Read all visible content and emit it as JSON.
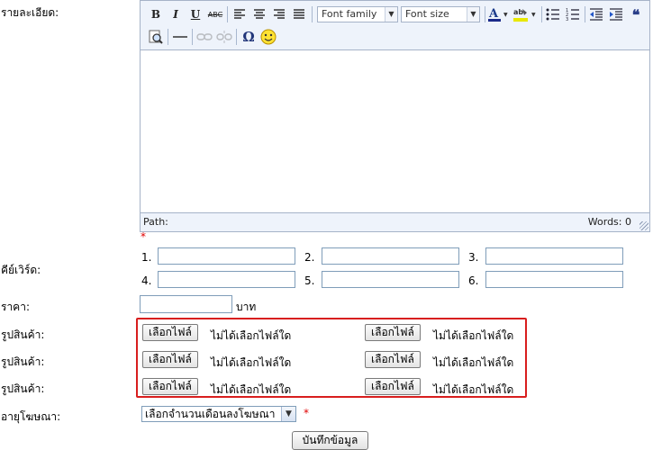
{
  "labels": {
    "detail": "รายละเอียด:",
    "keywords": "คีย์เวิร์ด:",
    "price": "ราคา:",
    "image": "รูปสินค้า:",
    "ad_duration": "อายุโฆษณา:"
  },
  "editor": {
    "toolbar": {
      "font_family": "Font family",
      "font_size": "Font size"
    },
    "status_path": "Path:",
    "word_count": "Words: 0"
  },
  "required_mark": "*",
  "keyword_numbers": [
    "1.",
    "2.",
    "3.",
    "4.",
    "5.",
    "6."
  ],
  "price_unit": "บาท",
  "uploads": {
    "button_label": "เลือกไฟล์",
    "no_file_text": "ไม่ได้เลือกไฟล์ใด"
  },
  "ad_duration_select": "เลือกจำนวนเดือนลงโฆษณา",
  "save_button": "บันทึกข้อมูล"
}
